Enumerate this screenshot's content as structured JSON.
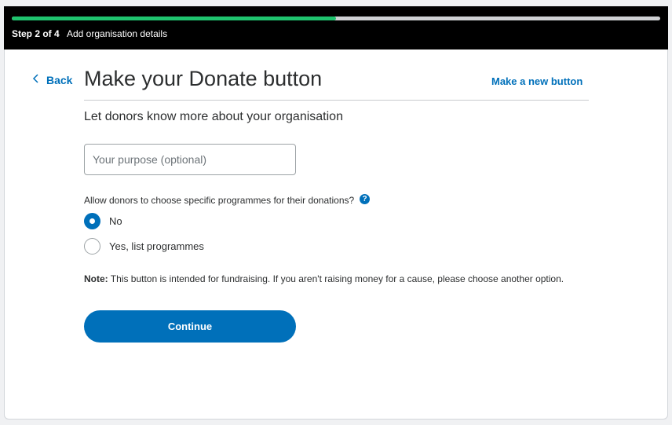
{
  "header": {
    "step_label": "Step 2 of 4",
    "step_description": "Add organisation details",
    "progress": 0.5,
    "progress_color": "#1fc36e"
  },
  "nav": {
    "back_label": "Back",
    "back_icon": "chevron-left-icon"
  },
  "page": {
    "title": "Make your Donate button",
    "new_button_link": "Make a new button",
    "subtitle": "Let donors know more about your organisation"
  },
  "form": {
    "purpose_placeholder": "Your purpose (optional)",
    "purpose_value": "",
    "programmes_question": "Allow donors to choose specific programmes for their donations?",
    "help_icon_glyph": "?",
    "options": [
      {
        "label": "No",
        "checked": true
      },
      {
        "label": "Yes, list programmes",
        "checked": false
      }
    ],
    "note_label": "Note:",
    "note_text": " This button is intended for fundraising. If you aren't raising money for a cause, please choose another option.",
    "continue_label": "Continue"
  },
  "colors": {
    "accent": "#0070ba",
    "header_bg": "#000000"
  }
}
